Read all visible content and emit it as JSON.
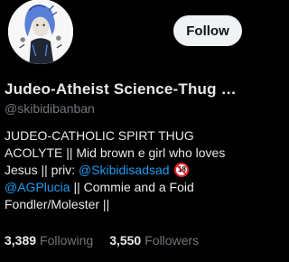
{
  "profile": {
    "display_name": "Judeo-Atheist Science-Thug M...",
    "handle": "@skibidibanban",
    "follow_label": "Follow",
    "bio": {
      "part1": "JUDEO-CATHOLIC SPIRT THUG ACOLYTE || Mid brown e girl who loves Jesus || priv: ",
      "mention1": "@Skibidisadsad",
      "age_badge": "18",
      "mention2": "@AGPlucia",
      "part2": " || Commie and a Foid Fondler/Molester ||"
    },
    "stats": {
      "following_count": "3,389",
      "following_label": "Following",
      "followers_count": "3,550",
      "followers_label": "Followers"
    }
  },
  "colors": {
    "background": "#000000",
    "text": "#e7e9ea",
    "muted": "#71767b",
    "link": "#1d9bf0",
    "button_bg": "#eff3f4"
  }
}
